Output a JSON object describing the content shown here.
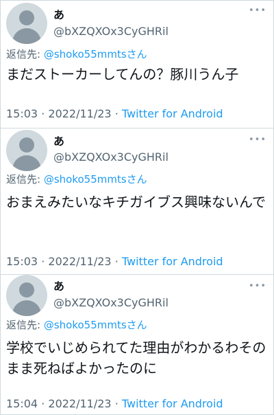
{
  "tweets": [
    {
      "display_name": "あ",
      "handle": "@bXZQXOx3CyGHRil",
      "more_glyph": "•••",
      "reply_prefix": "返信先:",
      "reply_to": "@shoko55mmtsさん",
      "text": "まだストーカーしてんの？豚川うん子",
      "time": "15:03",
      "sep": "·",
      "date": "2022/11/23",
      "client": "Twitter for Android"
    },
    {
      "display_name": "あ",
      "handle": "@bXZQXOx3CyGHRil",
      "more_glyph": "•••",
      "reply_prefix": "返信先:",
      "reply_to": "@shoko55mmtsさん",
      "text": "おまえみたいなキチガイブス興味ないんで",
      "time": "15:03",
      "sep": "·",
      "date": "2022/11/23",
      "client": "Twitter for Android"
    },
    {
      "display_name": "あ",
      "handle": "@bXZQXOx3CyGHRil",
      "more_glyph": "•••",
      "reply_prefix": "返信先:",
      "reply_to": "@shoko55mmtsさん",
      "text": "学校でいじめられてた理由がわかるわそのまま死ねばよかったのに",
      "time": "15:04",
      "sep": "·",
      "date": "2022/11/23",
      "client": "Twitter for Android"
    }
  ]
}
